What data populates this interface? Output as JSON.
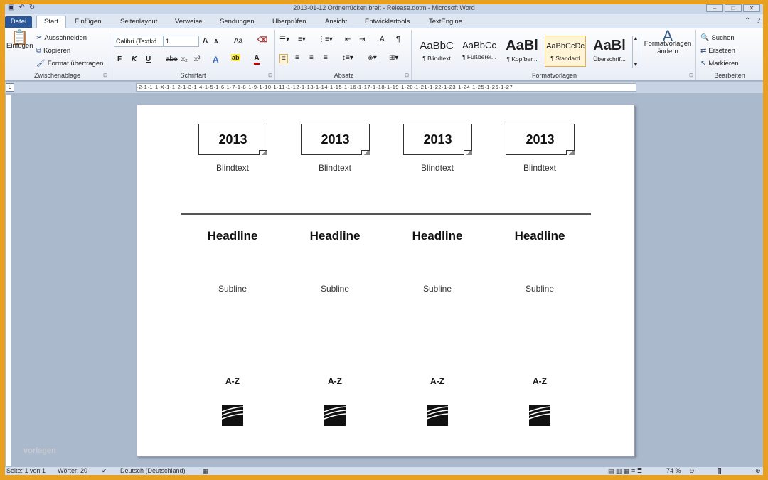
{
  "window": {
    "title": "2013-01-12 Ordnerrücken breit - Release.dotm - Microsoft Word"
  },
  "tabs": [
    {
      "label": "Datei"
    },
    {
      "label": "Start"
    },
    {
      "label": "Einfügen"
    },
    {
      "label": "Seitenlayout"
    },
    {
      "label": "Verweise"
    },
    {
      "label": "Sendungen"
    },
    {
      "label": "Überprüfen"
    },
    {
      "label": "Ansicht"
    },
    {
      "label": "Entwicklertools"
    },
    {
      "label": "TextEngine"
    }
  ],
  "clipboard": {
    "paste_label": "Einfügen",
    "cut_label": "Ausschneiden",
    "copy_label": "Kopieren",
    "format_painter_label": "Format übertragen",
    "group_label": "Zwischenablage"
  },
  "font": {
    "font_name": "Calibri (Textkö",
    "font_size": "1",
    "group_label": "Schriftart",
    "bold": "F",
    "italic": "K",
    "underline": "U",
    "strike": "abe",
    "subscript": "x₂",
    "superscript": "x²",
    "grow": "A",
    "shrink": "A",
    "case": "Aa"
  },
  "paragraph": {
    "group_label": "Absatz"
  },
  "styles": {
    "group_label": "Formatvorlagen",
    "items": [
      {
        "preview": "AaBbC",
        "name": "¶ Blindtext"
      },
      {
        "preview": "AaBbCc",
        "name": "¶ Fußberei..."
      },
      {
        "preview": "AaBl",
        "name": "¶ Kopfber..."
      },
      {
        "preview": "AaBbCcDc",
        "name": "¶ Standard"
      },
      {
        "preview": "AaBl",
        "name": "Überschrif..."
      }
    ],
    "change_label": "Formatvorlagen ändern"
  },
  "editing": {
    "group_label": "Bearbeiten",
    "find_label": "Suchen",
    "replace_label": "Ersetzen",
    "select_label": "Markieren"
  },
  "ruler": {
    "text": "·2·1·1·1·X·1·1·2·1·3·1·4·1·5·1·6·1·7·1·8·1·9·1·10·1·11·1·12·1·13·1·14·1·15·1·16·1·17·1·18·1·19·1·20·1·21·1·22·1·23·1·24·1·25·1·26·1·27"
  },
  "document": {
    "columns": [
      {
        "year": "2013",
        "blindtext": "Blindtext",
        "headline": "Headline",
        "subline": "Subline",
        "az": "A-Z"
      },
      {
        "year": "2013",
        "blindtext": "Blindtext",
        "headline": "Headline",
        "subline": "Subline",
        "az": "A-Z"
      },
      {
        "year": "2013",
        "blindtext": "Blindtext",
        "headline": "Headline",
        "subline": "Subline",
        "az": "A-Z"
      },
      {
        "year": "2013",
        "blindtext": "Blindtext",
        "headline": "Headline",
        "subline": "Subline",
        "az": "A-Z"
      }
    ]
  },
  "statusbar": {
    "page": "Seite: 1 von 1",
    "words": "Wörter: 20",
    "language": "Deutsch (Deutschland)",
    "zoom": "74 %"
  },
  "watermark": "vorlagen"
}
